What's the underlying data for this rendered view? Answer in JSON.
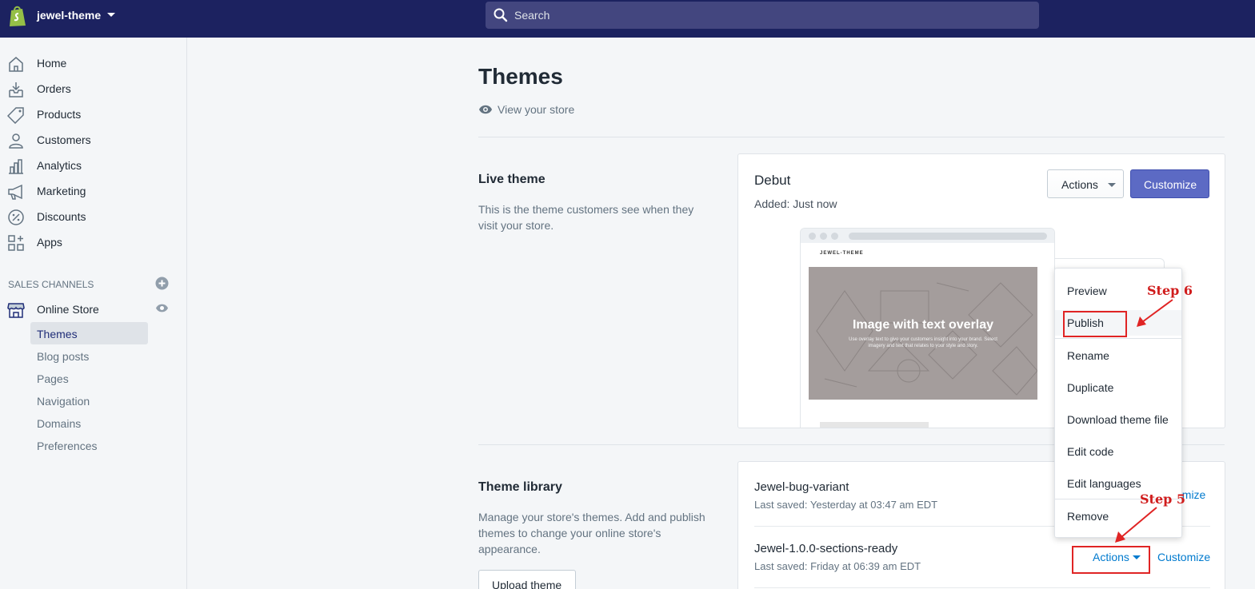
{
  "topbar": {
    "store_name": "jewel-theme",
    "search_placeholder": "Search",
    "icons": {
      "logo": "shopify-bag-icon",
      "caret": "caret-down-icon",
      "search": "search-icon"
    }
  },
  "sidebar": {
    "items": [
      {
        "label": "Home",
        "icon": "home-icon"
      },
      {
        "label": "Orders",
        "icon": "orders-icon"
      },
      {
        "label": "Products",
        "icon": "tag-icon"
      },
      {
        "label": "Customers",
        "icon": "person-icon"
      },
      {
        "label": "Analytics",
        "icon": "bar-chart-icon"
      },
      {
        "label": "Marketing",
        "icon": "megaphone-icon"
      },
      {
        "label": "Discounts",
        "icon": "discount-icon"
      },
      {
        "label": "Apps",
        "icon": "apps-icon"
      }
    ],
    "sales_channels_title": "SALES CHANNELS",
    "online_store": {
      "label": "Online Store",
      "icon": "store-icon"
    },
    "sub_items": [
      "Themes",
      "Blog posts",
      "Pages",
      "Navigation",
      "Domains",
      "Preferences"
    ],
    "active_sub_item": "Themes"
  },
  "main": {
    "title": "Themes",
    "view_store": "View your store",
    "live_theme": {
      "heading": "Live theme",
      "description": "This is the theme customers see when they visit your store.",
      "theme_name": "Debut",
      "added": "Added: Just now",
      "actions_label": "Actions",
      "customize_label": "Customize",
      "preview": {
        "brand": "JEWEL-THEME",
        "hero_title": "Image with text overlay",
        "hero_subtitle": "Use overlay text to give your customers insight into your brand. Select imagery and text that relates to your style and story."
      }
    },
    "theme_library": {
      "heading": "Theme library",
      "description": "Manage your store's themes. Add and publish themes to change your online store's appearance.",
      "upload_label": "Upload theme",
      "themes": [
        {
          "name": "Jewel-bug-variant",
          "saved": "Last saved: Yesterday at 03:47 am EDT",
          "customize_partial": "omize"
        },
        {
          "name": "Jewel-1.0.0-sections-ready",
          "saved": "Last saved: Friday at 06:39 am EDT",
          "actions_label": "Actions",
          "customize_label": "Customize"
        }
      ]
    }
  },
  "dropdown": {
    "items": [
      "Preview",
      "Publish",
      "Rename",
      "Duplicate",
      "Download theme file",
      "Edit code",
      "Edit languages",
      "Remove"
    ],
    "highlighted": "Publish"
  },
  "annotations": {
    "step6": "Step 6",
    "step5": "Step 5",
    "color": "#e02424"
  },
  "colors": {
    "topbar": "#1c2260",
    "primary_button": "#5c6ac4",
    "link": "#007ace",
    "preview_hero": "#a49d9c"
  }
}
